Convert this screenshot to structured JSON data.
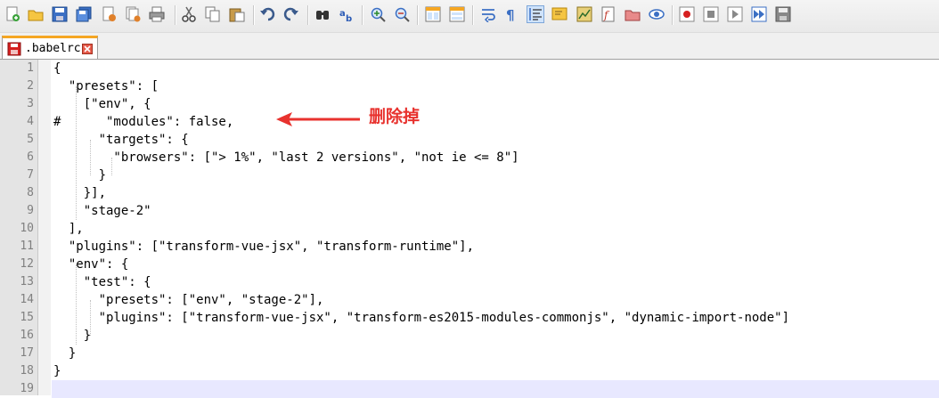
{
  "tab": {
    "filename": ".babelrc"
  },
  "editor": {
    "lines": [
      {
        "n": "1",
        "text": "{"
      },
      {
        "n": "2",
        "text": "  \"presets\": ["
      },
      {
        "n": "3",
        "text": "    [\"env\", {"
      },
      {
        "n": "4",
        "text": "#      \"modules\": false,"
      },
      {
        "n": "5",
        "text": "      \"targets\": {"
      },
      {
        "n": "6",
        "text": "        \"browsers\": [\"> 1%\", \"last 2 versions\", \"not ie <= 8\"]"
      },
      {
        "n": "7",
        "text": "      }"
      },
      {
        "n": "8",
        "text": "    }],"
      },
      {
        "n": "9",
        "text": "    \"stage-2\""
      },
      {
        "n": "10",
        "text": "  ],"
      },
      {
        "n": "11",
        "text": "  \"plugins\": [\"transform-vue-jsx\", \"transform-runtime\"],"
      },
      {
        "n": "12",
        "text": "  \"env\": {"
      },
      {
        "n": "13",
        "text": "    \"test\": {"
      },
      {
        "n": "14",
        "text": "      \"presets\": [\"env\", \"stage-2\"],"
      },
      {
        "n": "15",
        "text": "      \"plugins\": [\"transform-vue-jsx\", \"transform-es2015-modules-commonjs\", \"dynamic-import-node\"]"
      },
      {
        "n": "16",
        "text": "    }"
      },
      {
        "n": "17",
        "text": "  }"
      },
      {
        "n": "18",
        "text": "}"
      },
      {
        "n": "19",
        "text": ""
      }
    ],
    "current_line": "19"
  },
  "annotation": {
    "text": "删除掉",
    "color": "#e8322e"
  },
  "colors": {
    "accent": "#f5a623",
    "current_line_bg": "#e8e8ff"
  },
  "toolbar_icons": [
    "new-file-icon",
    "open-file-icon",
    "save-icon",
    "save-all-icon",
    "close-icon",
    "close-all-icon",
    "print-icon",
    "cut-icon",
    "copy-icon",
    "paste-icon",
    "undo-icon",
    "redo-icon",
    "find-icon",
    "replace-icon",
    "zoom-in-icon",
    "zoom-out-icon",
    "sync-vertical-icon",
    "sync-horizontal-icon",
    "word-wrap-icon",
    "show-all-characters-icon",
    "indent-guide-icon",
    "user-language-icon",
    "document-map-icon",
    "function-list-icon",
    "folder-workspace-icon",
    "monitoring-icon",
    "record-macro-icon",
    "stop-macro-icon",
    "play-macro-icon",
    "run-macro-multiple-icon",
    "save-macro-icon"
  ]
}
